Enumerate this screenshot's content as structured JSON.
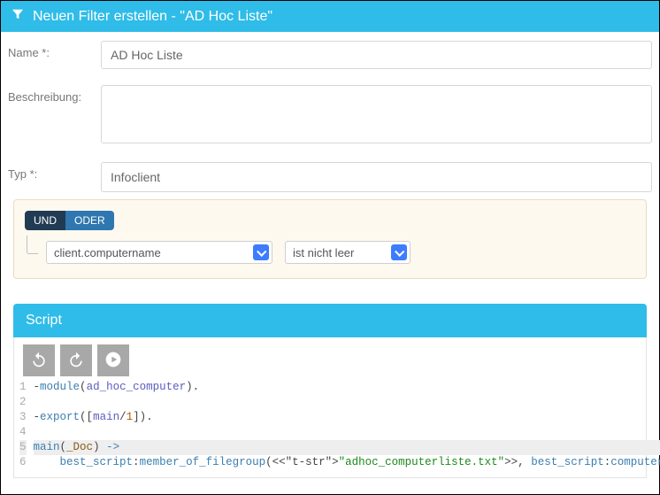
{
  "header": {
    "title": "Neuen Filter erstellen - \"AD Hoc Liste\""
  },
  "form": {
    "name_label": "Name *:",
    "name_value": "AD Hoc Liste",
    "desc_label": "Beschreibung:",
    "desc_value": "",
    "type_label": "Typ *:",
    "type_value": "Infoclient"
  },
  "filter": {
    "und_label": "UND",
    "oder_label": "ODER",
    "active_logic": "UND",
    "condition": {
      "field": "client.computername",
      "operator": "ist nicht leer"
    }
  },
  "script": {
    "panel_title": "Script",
    "lines": [
      "-module(ad_hoc_computer).",
      "",
      "-export([main/1]).",
      "",
      "main(_Doc) ->",
      "    best_script:member_of_filegroup(<<\"adhoc_computerliste.txt\">>, best_script:computername())."
    ],
    "highlighted_line_index": 4
  }
}
